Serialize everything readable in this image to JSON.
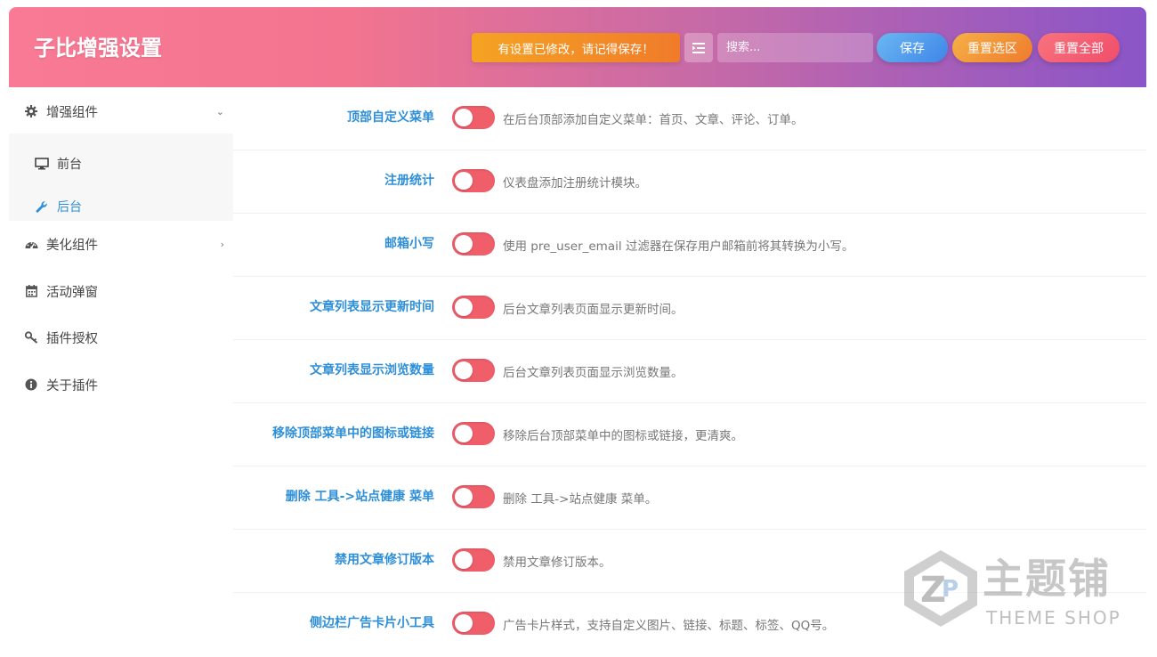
{
  "header": {
    "title": "子比增强设置",
    "notice": "有设置已修改，请记得保存！",
    "search_placeholder": "搜索...",
    "save_label": "保存",
    "reset_section_label": "重置选区",
    "reset_all_label": "重置全部",
    "gradient_colors": [
      "#f97a94",
      "#8a55c8"
    ]
  },
  "sidebar": {
    "items": [
      {
        "label": "增强组件",
        "icon": "gear-icon",
        "expanded": true
      },
      {
        "label": "美化组件",
        "icon": "dashboard-icon",
        "expanded": false
      },
      {
        "label": "活动弹窗",
        "icon": "calendar-icon"
      },
      {
        "label": "插件授权",
        "icon": "key-icon"
      },
      {
        "label": "关于插件",
        "icon": "info-circle-icon"
      }
    ],
    "sub_items": [
      {
        "label": "前台",
        "icon": "monitor-icon",
        "active": false
      },
      {
        "label": "后台",
        "icon": "wrench-icon",
        "active": true
      }
    ]
  },
  "settings": [
    {
      "label": "顶部自定义菜单",
      "desc": "在后台顶部添加自定义菜单：首页、文章、评论、订单。",
      "enabled": false
    },
    {
      "label": "注册统计",
      "desc": "仪表盘添加注册统计模块。",
      "enabled": false
    },
    {
      "label": "邮箱小写",
      "desc": "使用 pre_user_email 过滤器在保存用户邮箱前将其转换为小写。",
      "enabled": false
    },
    {
      "label": "文章列表显示更新时间",
      "desc": "后台文章列表页面显示更新时间。",
      "enabled": false
    },
    {
      "label": "文章列表显示浏览数量",
      "desc": "后台文章列表页面显示浏览数量。",
      "enabled": false
    },
    {
      "label": "移除顶部菜单中的图标或链接",
      "desc": "移除后台顶部菜单中的图标或链接，更清爽。",
      "enabled": false
    },
    {
      "label": "删除 工具->站点健康 菜单",
      "desc": "删除 工具->站点健康 菜单。",
      "enabled": false
    },
    {
      "label": "禁用文章修订版本",
      "desc": "禁用文章修订版本。",
      "enabled": false
    },
    {
      "label": "侧边栏广告卡片小工具",
      "desc": "广告卡片样式，支持自定义图片、链接、标题、标签、QQ号。",
      "enabled": false
    }
  ],
  "watermark": {
    "title": "主题铺",
    "subtitle": "THEME SHOP"
  },
  "colors": {
    "accent": "#2e8fd8",
    "toggle_off": "#f05e6a"
  }
}
